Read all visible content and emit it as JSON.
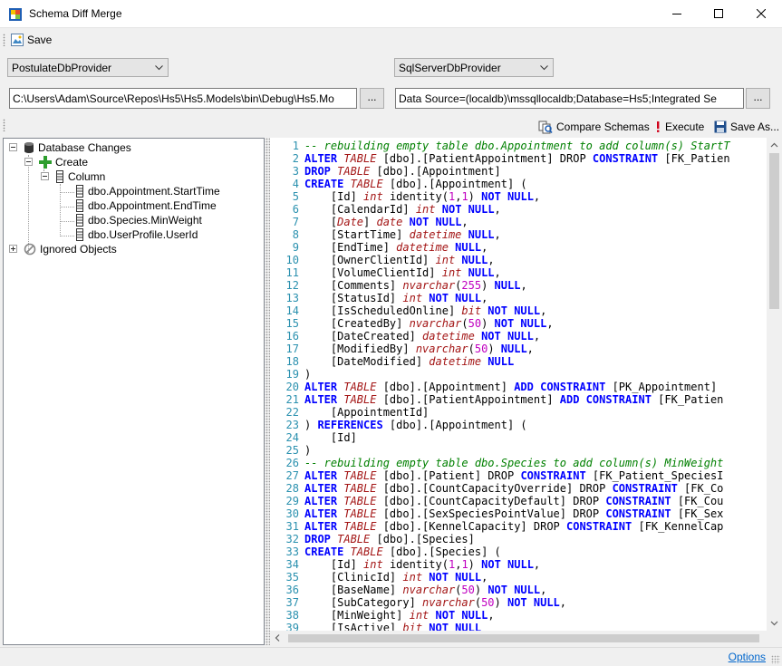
{
  "window": {
    "title": "Schema Diff Merge"
  },
  "toolbar": {
    "save_label": "Save"
  },
  "source": {
    "provider": "PostulateDbProvider",
    "path": "C:\\Users\\Adam\\Source\\Repos\\Hs5\\Hs5.Models\\bin\\Debug\\Hs5.Mo",
    "browse_label": "..."
  },
  "target": {
    "provider": "SqlServerDbProvider",
    "connection": "Data Source=(localdb)\\mssqllocaldb;Database=Hs5;Integrated Se",
    "browse_label": "..."
  },
  "actions": {
    "compare_label": "Compare Schemas",
    "execute_label": "Execute",
    "save_as_label": "Save As..."
  },
  "tree": {
    "root": "Database Changes",
    "create": "Create",
    "column": "Column",
    "columns": [
      "dbo.Appointment.StartTime",
      "dbo.Appointment.EndTime",
      "dbo.Species.MinWeight",
      "dbo.UserProfile.UserId"
    ],
    "ignored": "Ignored Objects"
  },
  "editor": {
    "line_numbers": [
      "1",
      "2",
      "3",
      "4",
      "5",
      "6",
      "7",
      "8",
      "9",
      "10",
      "11",
      "12",
      "13",
      "14",
      "15",
      "16",
      "17",
      "18",
      "19",
      "20",
      "21",
      "22",
      "23",
      "24",
      "25",
      "26",
      "27",
      "28",
      "29",
      "30",
      "31",
      "32",
      "33",
      "34",
      "35",
      "36",
      "37",
      "38",
      "39"
    ],
    "lines": [
      [
        [
          "cm",
          "-- rebuilding empty table dbo.Appointment to add column(s) StartT"
        ]
      ],
      [
        [
          "kw",
          "ALTER "
        ],
        [
          "kwi",
          "TABLE"
        ],
        [
          "txt",
          " [dbo].[PatientAppointment] DROP "
        ],
        [
          "kw",
          "CONSTRAINT"
        ],
        [
          "txt",
          " [FK_Patien"
        ]
      ],
      [
        [
          "kw",
          "DROP "
        ],
        [
          "kwi",
          "TABLE"
        ],
        [
          "txt",
          " [dbo].[Appointment]"
        ]
      ],
      [
        [
          "kw",
          "CREATE "
        ],
        [
          "kwi",
          "TABLE"
        ],
        [
          "txt",
          " [dbo].[Appointment] ("
        ]
      ],
      [
        [
          "txt",
          "    [Id] "
        ],
        [
          "typ",
          "int"
        ],
        [
          "txt",
          " identity("
        ],
        [
          "num",
          "1"
        ],
        [
          "txt",
          ","
        ],
        [
          "num",
          "1"
        ],
        [
          "txt",
          ") "
        ],
        [
          "kw",
          "NOT NULL"
        ],
        [
          "txt",
          ","
        ]
      ],
      [
        [
          "txt",
          "    [CalendarId] "
        ],
        [
          "typ",
          "int"
        ],
        [
          "kw",
          " NOT NULL"
        ],
        [
          "txt",
          ","
        ]
      ],
      [
        [
          "txt",
          "    ["
        ],
        [
          "typ",
          "Date"
        ],
        [
          "txt",
          "] "
        ],
        [
          "typ",
          "date"
        ],
        [
          "kw",
          " NOT NULL"
        ],
        [
          "txt",
          ","
        ]
      ],
      [
        [
          "txt",
          "    [StartTime] "
        ],
        [
          "typ",
          "datetime"
        ],
        [
          "kw",
          " NULL"
        ],
        [
          "txt",
          ","
        ]
      ],
      [
        [
          "txt",
          "    [EndTime] "
        ],
        [
          "typ",
          "datetime"
        ],
        [
          "kw",
          " NULL"
        ],
        [
          "txt",
          ","
        ]
      ],
      [
        [
          "txt",
          "    [OwnerClientId] "
        ],
        [
          "typ",
          "int"
        ],
        [
          "kw",
          " NULL"
        ],
        [
          "txt",
          ","
        ]
      ],
      [
        [
          "txt",
          "    [VolumeClientId] "
        ],
        [
          "typ",
          "int"
        ],
        [
          "kw",
          " NULL"
        ],
        [
          "txt",
          ","
        ]
      ],
      [
        [
          "txt",
          "    [Comments] "
        ],
        [
          "typ",
          "nvarchar"
        ],
        [
          "txt",
          "("
        ],
        [
          "num",
          "255"
        ],
        [
          "txt",
          ") "
        ],
        [
          "kw",
          "NULL"
        ],
        [
          "txt",
          ","
        ]
      ],
      [
        [
          "txt",
          "    [StatusId] "
        ],
        [
          "typ",
          "int"
        ],
        [
          "kw",
          " NOT NULL"
        ],
        [
          "txt",
          ","
        ]
      ],
      [
        [
          "txt",
          "    [IsScheduledOnline] "
        ],
        [
          "typ",
          "bit"
        ],
        [
          "kw",
          " NOT NULL"
        ],
        [
          "txt",
          ","
        ]
      ],
      [
        [
          "txt",
          "    [CreatedBy] "
        ],
        [
          "typ",
          "nvarchar"
        ],
        [
          "txt",
          "("
        ],
        [
          "num",
          "50"
        ],
        [
          "txt",
          ") "
        ],
        [
          "kw",
          "NOT NULL"
        ],
        [
          "txt",
          ","
        ]
      ],
      [
        [
          "txt",
          "    [DateCreated] "
        ],
        [
          "typ",
          "datetime"
        ],
        [
          "kw",
          " NOT NULL"
        ],
        [
          "txt",
          ","
        ]
      ],
      [
        [
          "txt",
          "    [ModifiedBy] "
        ],
        [
          "typ",
          "nvarchar"
        ],
        [
          "txt",
          "("
        ],
        [
          "num",
          "50"
        ],
        [
          "txt",
          ") "
        ],
        [
          "kw",
          "NULL"
        ],
        [
          "txt",
          ","
        ]
      ],
      [
        [
          "txt",
          "    [DateModified] "
        ],
        [
          "typ",
          "datetime"
        ],
        [
          "kw",
          " NULL"
        ]
      ],
      [
        [
          "txt",
          ")"
        ]
      ],
      [
        [
          "kw",
          "ALTER "
        ],
        [
          "kwi",
          "TABLE"
        ],
        [
          "txt",
          " [dbo].[Appointment] "
        ],
        [
          "kw",
          "ADD CONSTRAINT"
        ],
        [
          "txt",
          " [PK_Appointment]"
        ]
      ],
      [
        [
          "kw",
          "ALTER "
        ],
        [
          "kwi",
          "TABLE"
        ],
        [
          "txt",
          " [dbo].[PatientAppointment] "
        ],
        [
          "kw",
          "ADD CONSTRAINT"
        ],
        [
          "txt",
          " [FK_Patien"
        ]
      ],
      [
        [
          "txt",
          "    [AppointmentId]"
        ]
      ],
      [
        [
          "txt",
          ") "
        ],
        [
          "kw",
          "REFERENCES"
        ],
        [
          "txt",
          " [dbo].[Appointment] ("
        ]
      ],
      [
        [
          "txt",
          "    [Id]"
        ]
      ],
      [
        [
          "txt",
          ")"
        ]
      ],
      [
        [
          "cm",
          "-- rebuilding empty table dbo.Species to add column(s) MinWeight"
        ]
      ],
      [
        [
          "kw",
          "ALTER "
        ],
        [
          "kwi",
          "TABLE"
        ],
        [
          "txt",
          " [dbo].[Patient] DROP "
        ],
        [
          "kw",
          "CONSTRAINT"
        ],
        [
          "txt",
          " [FK_Patient_SpeciesI"
        ]
      ],
      [
        [
          "kw",
          "ALTER "
        ],
        [
          "kwi",
          "TABLE"
        ],
        [
          "txt",
          " [dbo].[CountCapacityOverride] DROP "
        ],
        [
          "kw",
          "CONSTRAINT"
        ],
        [
          "txt",
          " [FK_Co"
        ]
      ],
      [
        [
          "kw",
          "ALTER "
        ],
        [
          "kwi",
          "TABLE"
        ],
        [
          "txt",
          " [dbo].[CountCapacityDefault] DROP "
        ],
        [
          "kw",
          "CONSTRAINT"
        ],
        [
          "txt",
          " [FK_Cou"
        ]
      ],
      [
        [
          "kw",
          "ALTER "
        ],
        [
          "kwi",
          "TABLE"
        ],
        [
          "txt",
          " [dbo].[SexSpeciesPointValue] DROP "
        ],
        [
          "kw",
          "CONSTRAINT"
        ],
        [
          "txt",
          " [FK_Sex"
        ]
      ],
      [
        [
          "kw",
          "ALTER "
        ],
        [
          "kwi",
          "TABLE"
        ],
        [
          "txt",
          " [dbo].[KennelCapacity] DROP "
        ],
        [
          "kw",
          "CONSTRAINT"
        ],
        [
          "txt",
          " [FK_KennelCap"
        ]
      ],
      [
        [
          "kw",
          "DROP "
        ],
        [
          "kwi",
          "TABLE"
        ],
        [
          "txt",
          " [dbo].[Species]"
        ]
      ],
      [
        [
          "kw",
          "CREATE "
        ],
        [
          "kwi",
          "TABLE"
        ],
        [
          "txt",
          " [dbo].[Species] ("
        ]
      ],
      [
        [
          "txt",
          "    [Id] "
        ],
        [
          "typ",
          "int"
        ],
        [
          "txt",
          " identity("
        ],
        [
          "num",
          "1"
        ],
        [
          "txt",
          ","
        ],
        [
          "num",
          "1"
        ],
        [
          "txt",
          ") "
        ],
        [
          "kw",
          "NOT NULL"
        ],
        [
          "txt",
          ","
        ]
      ],
      [
        [
          "txt",
          "    [ClinicId] "
        ],
        [
          "typ",
          "int"
        ],
        [
          "kw",
          " NOT NULL"
        ],
        [
          "txt",
          ","
        ]
      ],
      [
        [
          "txt",
          "    [BaseName] "
        ],
        [
          "typ",
          "nvarchar"
        ],
        [
          "txt",
          "("
        ],
        [
          "num",
          "50"
        ],
        [
          "txt",
          ") "
        ],
        [
          "kw",
          "NOT NULL"
        ],
        [
          "txt",
          ","
        ]
      ],
      [
        [
          "txt",
          "    [SubCategory] "
        ],
        [
          "typ",
          "nvarchar"
        ],
        [
          "txt",
          "("
        ],
        [
          "num",
          "50"
        ],
        [
          "txt",
          ") "
        ],
        [
          "kw",
          "NOT NULL"
        ],
        [
          "txt",
          ","
        ]
      ],
      [
        [
          "txt",
          "    [MinWeight] "
        ],
        [
          "typ",
          "int"
        ],
        [
          "kw",
          " NOT NULL"
        ],
        [
          "txt",
          ","
        ]
      ],
      [
        [
          "txt",
          "    [IsActive] "
        ],
        [
          "typ",
          "bit"
        ],
        [
          "kw",
          " NOT NULL"
        ]
      ]
    ]
  },
  "status": {
    "options_label": "Options"
  },
  "colors": {
    "keyword": "#0000ff",
    "type": "#a31515",
    "number": "#c000c0",
    "comment": "#008000",
    "line_number": "#2b91af",
    "link": "#0066cc"
  }
}
